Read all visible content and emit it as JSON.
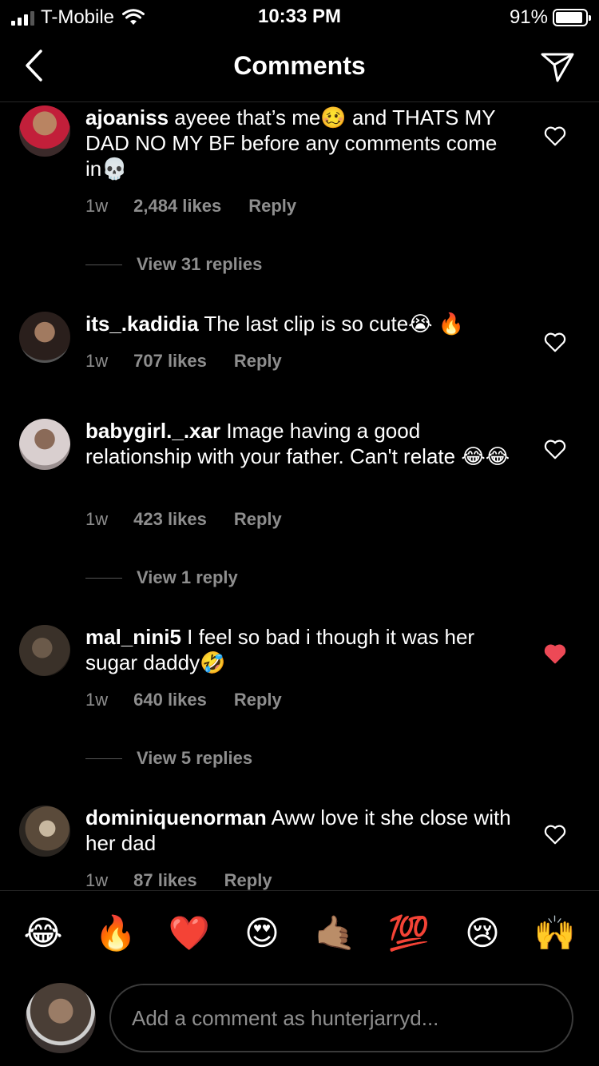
{
  "status_bar": {
    "carrier": "T-Mobile",
    "time": "10:33 PM",
    "battery": "91%",
    "battery_level": 0.91
  },
  "header": {
    "title": "Comments",
    "back_icon": "chevron-left-icon",
    "send_icon": "paper-plane-icon"
  },
  "comments": [
    {
      "username": "ajoaniss",
      "text": "ayeee that’s me🥴 and THATS MY DAD NO MY BF before any comments come in💀",
      "time": "1w",
      "likes": "2,484 likes",
      "reply": "Reply",
      "liked": false,
      "view_replies": "View 31 replies"
    },
    {
      "username": "its_.kadidia",
      "text": "The last clip is so cute😭 🔥",
      "time": "1w",
      "likes": "707 likes",
      "reply": "Reply",
      "liked": false,
      "view_replies": ""
    },
    {
      "username": "babygirl._.xar",
      "text": "Image having a good relationship with your father. Can't relate 😂😂",
      "time": "1w",
      "likes": "423 likes",
      "reply": "Reply",
      "liked": false,
      "view_replies": "View 1 reply"
    },
    {
      "username": "mal_nini5",
      "text": "I feel so bad i though it was her sugar daddy🤣",
      "time": "1w",
      "likes": "640 likes",
      "reply": "Reply",
      "liked": true,
      "view_replies": "View 5 replies"
    },
    {
      "username": "dominiquenorman",
      "text": "Aww love it she close with her dad",
      "time": "1w",
      "likes": "87 likes",
      "reply": "Reply",
      "liked": false,
      "view_replies": ""
    }
  ],
  "emoji_bar": [
    "😂",
    "🔥",
    "❤️",
    "😍",
    "🤙🏽",
    "💯",
    "😢",
    "🙌"
  ],
  "composer": {
    "placeholder": "Add a comment as hunterjarryd..."
  },
  "colors": {
    "background": "#000000",
    "secondary_text": "#8e8e8e",
    "liked_heart": "#ed4956",
    "divider": "#262626"
  }
}
